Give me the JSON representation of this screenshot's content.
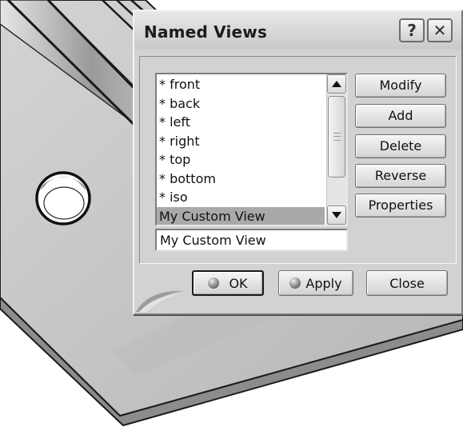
{
  "dialog": {
    "title": "Named Views",
    "help_symbol": "?",
    "close_symbol": "✕"
  },
  "views_list": {
    "items": [
      "* front",
      "* back",
      "* left",
      "* right",
      "* top",
      "* bottom",
      "* iso",
      "My Custom View"
    ],
    "selected": "My Custom View"
  },
  "name_field": {
    "value": "My Custom View"
  },
  "side_buttons": {
    "modify": "Modify",
    "add": "Add",
    "delete": "Delete",
    "reverse": "Reverse",
    "properties": "Properties"
  },
  "bottom_buttons": {
    "ok": "OK",
    "apply": "Apply",
    "close": "Close"
  },
  "icons": {
    "help": "question-mark-icon",
    "close": "close-x-icon",
    "scroll_up": "triangle-up-icon",
    "scroll_down": "triangle-down-icon",
    "ok": "sphere-icon",
    "apply": "sphere-icon"
  },
  "colors": {
    "dialog_bg": "#d2d2d2",
    "selection": "#a9a9a9",
    "part_face": "#c4c4c4"
  }
}
